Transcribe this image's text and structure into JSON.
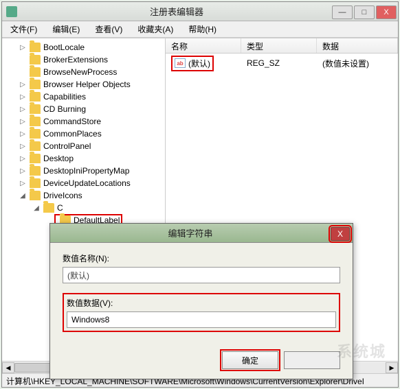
{
  "window": {
    "title": "注册表编辑器",
    "controls": {
      "min": "—",
      "max": "□",
      "close": "X"
    }
  },
  "menu": {
    "file": "文件(F)",
    "edit": "编辑(E)",
    "view": "查看(V)",
    "favorites": "收藏夹(A)",
    "help": "帮助(H)"
  },
  "tree": {
    "items": [
      {
        "label": "BootLocale",
        "depth": 1,
        "exp": "▷"
      },
      {
        "label": "BrokerExtensions",
        "depth": 1,
        "exp": ""
      },
      {
        "label": "BrowseNewProcess",
        "depth": 1,
        "exp": ""
      },
      {
        "label": "Browser Helper Objects",
        "depth": 1,
        "exp": "▷"
      },
      {
        "label": "Capabilities",
        "depth": 1,
        "exp": "▷"
      },
      {
        "label": "CD Burning",
        "depth": 1,
        "exp": "▷"
      },
      {
        "label": "CommandStore",
        "depth": 1,
        "exp": "▷"
      },
      {
        "label": "CommonPlaces",
        "depth": 1,
        "exp": "▷"
      },
      {
        "label": "ControlPanel",
        "depth": 1,
        "exp": "▷"
      },
      {
        "label": "Desktop",
        "depth": 1,
        "exp": "▷"
      },
      {
        "label": "DesktopIniPropertyMap",
        "depth": 1,
        "exp": "▷"
      },
      {
        "label": "DeviceUpdateLocations",
        "depth": 1,
        "exp": "▷"
      },
      {
        "label": "DriveIcons",
        "depth": 1,
        "exp": "◢",
        "expanded": true
      },
      {
        "label": "C",
        "depth": 2,
        "exp": "◢",
        "expanded": true
      },
      {
        "label": "DefaultLabel",
        "depth": 3,
        "exp": "",
        "highlight": true
      }
    ]
  },
  "columns": {
    "name": "名称",
    "type": "类型",
    "data": "数据"
  },
  "values": [
    {
      "icon": "ab",
      "name": "(默认)",
      "type": "REG_SZ",
      "data": "(数值未设置)",
      "highlight": true
    }
  ],
  "statusbar": "计算机\\HKEY_LOCAL_MACHINE\\SOFTWARE\\Microsoft\\Windows\\CurrentVersion\\Explorer\\DriveI",
  "dialog": {
    "title": "编辑字符串",
    "name_label": "数值名称(N):",
    "name_value": "(默认)",
    "data_label": "数值数据(V):",
    "data_value": "Windows8",
    "ok": "确定",
    "cancel": ""
  },
  "watermark": "系统城"
}
